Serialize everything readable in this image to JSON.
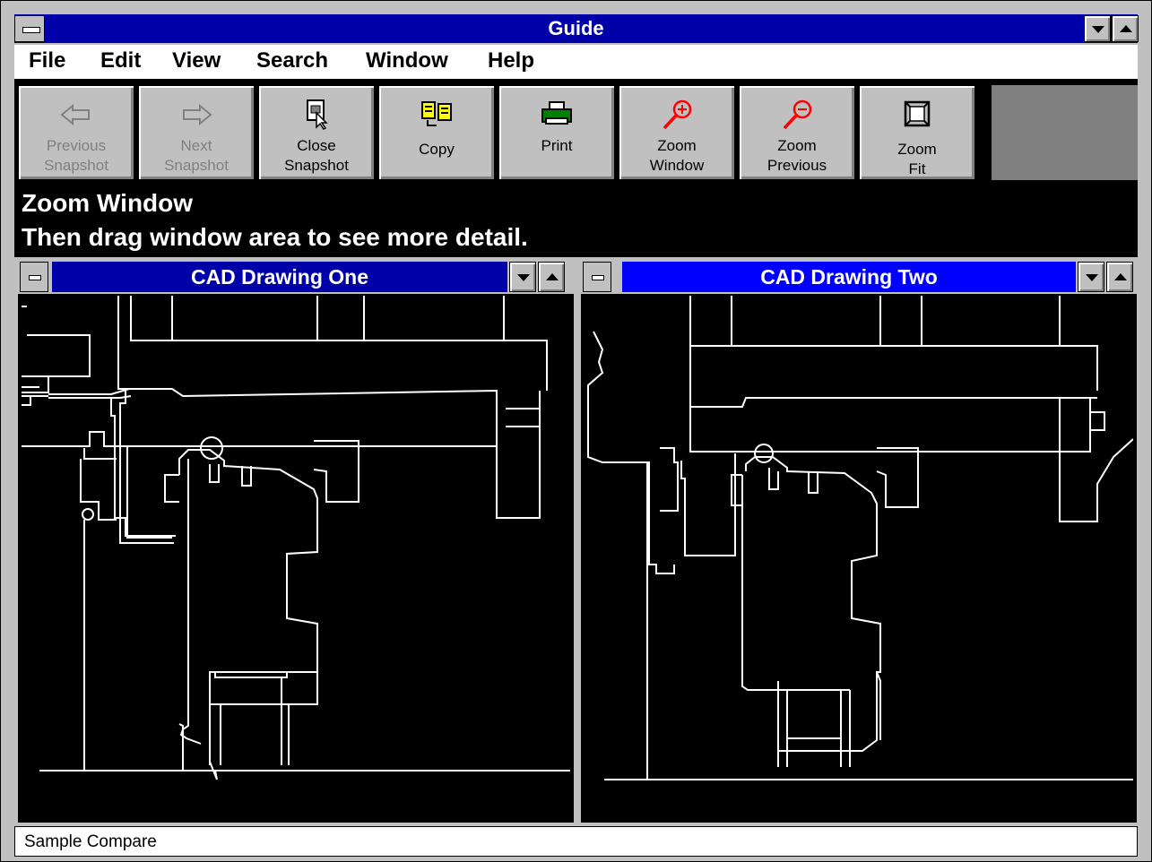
{
  "window": {
    "title": "Guide"
  },
  "menu": [
    "File",
    "Edit",
    "View",
    "Search",
    "Window",
    "Help"
  ],
  "toolbar": {
    "buttons": [
      {
        "label": "Previous\nSnapshot",
        "icon": "left-arrow-icon",
        "enabled": false
      },
      {
        "label": "Next\nSnapshot",
        "icon": "right-arrow-icon",
        "enabled": false
      },
      {
        "label": "Close\nSnapshot",
        "icon": "close-snapshot-icon",
        "enabled": true
      },
      {
        "label": "Copy",
        "icon": "copy-icon",
        "enabled": true
      },
      {
        "label": "Print",
        "icon": "printer-icon",
        "enabled": true
      },
      {
        "label": "Zoom\nWindow",
        "icon": "zoom-in-icon",
        "enabled": true
      },
      {
        "label": "Zoom\nPrevious",
        "icon": "zoom-out-icon",
        "enabled": true
      },
      {
        "label": "Zoom\nFit",
        "icon": "zoom-fit-icon",
        "enabled": true
      }
    ]
  },
  "hint": {
    "line1": "Zoom Window",
    "line2": "Then drag window area to see more detail."
  },
  "panes": [
    {
      "title": "CAD Drawing  One",
      "active": false
    },
    {
      "title": "CAD Drawing Two",
      "active": true
    }
  ],
  "status": {
    "text": "Sample Compare"
  },
  "colors": {
    "titlebar": "#0000a8",
    "active_pane": "#0000ff",
    "inactive_pane": "#0000a8",
    "disabled_text": "#808080",
    "zoom_icon": "#ff0000",
    "print_icon": "#008000",
    "copy_icon": "#ffff00"
  }
}
